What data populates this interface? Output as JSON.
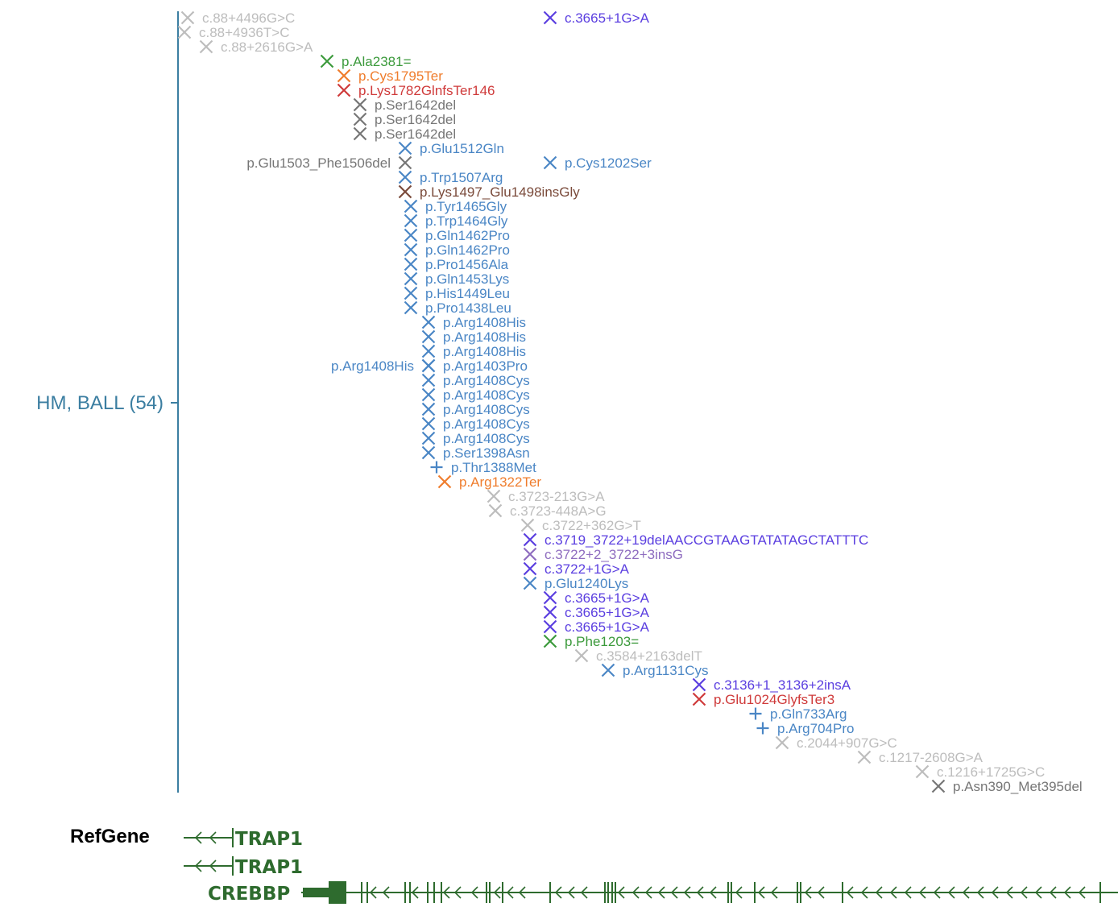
{
  "track": {
    "label": "HM, BALL (54)",
    "axis_color": "#3b7ea1"
  },
  "colors": {
    "gray": "#bdbdbd",
    "darkgray": "#767676",
    "blue": "#4a86c5",
    "purple": "#5b3fe0",
    "violet": "#8e6cbf",
    "green": "#3c9a3c",
    "orange": "#ef7d2d",
    "red": "#cf3a3a",
    "brown": "#7a4a3a",
    "gene": "#2e6b2e"
  },
  "mutations": [
    {
      "label": "c.88+4496G>C",
      "color": "gray",
      "marker": "x"
    },
    {
      "label": "c.88+4936T>C",
      "color": "gray",
      "marker": "x"
    },
    {
      "label": "c.88+2616G>A",
      "color": "gray",
      "marker": "x"
    },
    {
      "label": "p.Ala2381=",
      "color": "green",
      "marker": "x"
    },
    {
      "label": "p.Cys1795Ter",
      "color": "orange",
      "marker": "x"
    },
    {
      "label": "p.Lys1782GlnfsTer146",
      "color": "red",
      "marker": "x"
    },
    {
      "label": "p.Ser1642del",
      "color": "darkgray",
      "marker": "x"
    },
    {
      "label": "p.Ser1642del",
      "color": "darkgray",
      "marker": "x"
    },
    {
      "label": "p.Ser1642del",
      "color": "darkgray",
      "marker": "x"
    },
    {
      "label": "p.Glu1512Gln",
      "color": "blue",
      "marker": "x"
    },
    {
      "label": "p.Glu1503_Phe1506del",
      "color": "darkgray",
      "marker": "x",
      "side": "left"
    },
    {
      "label": "p.Trp1507Arg",
      "color": "blue",
      "marker": "x"
    },
    {
      "label": "p.Lys1497_Glu1498insGly",
      "color": "brown",
      "marker": "x"
    },
    {
      "label": "p.Tyr1465Gly",
      "color": "blue",
      "marker": "x"
    },
    {
      "label": "p.Trp1464Gly",
      "color": "blue",
      "marker": "x"
    },
    {
      "label": "p.Gln1462Pro",
      "color": "blue",
      "marker": "x"
    },
    {
      "label": "p.Gln1462Pro",
      "color": "blue",
      "marker": "x"
    },
    {
      "label": "p.Pro1456Ala",
      "color": "blue",
      "marker": "x"
    },
    {
      "label": "p.Gln1453Lys",
      "color": "blue",
      "marker": "x"
    },
    {
      "label": "p.His1449Leu",
      "color": "blue",
      "marker": "x"
    },
    {
      "label": "p.Pro1438Leu",
      "color": "blue",
      "marker": "x"
    },
    {
      "label": "p.Arg1408His",
      "color": "blue",
      "marker": "x"
    },
    {
      "label": "p.Arg1408His",
      "color": "blue",
      "marker": "x"
    },
    {
      "label": "p.Arg1408His",
      "color": "blue",
      "marker": "x"
    },
    {
      "label": "p.Arg1408His",
      "color": "blue",
      "marker": "x",
      "side": "left"
    },
    {
      "label": "p.Arg1403Pro",
      "color": "blue",
      "marker": "x"
    },
    {
      "label": "p.Arg1408Cys",
      "color": "blue",
      "marker": "x"
    },
    {
      "label": "p.Arg1408Cys",
      "color": "blue",
      "marker": "x"
    },
    {
      "label": "p.Arg1408Cys",
      "color": "blue",
      "marker": "x"
    },
    {
      "label": "p.Arg1408Cys",
      "color": "blue",
      "marker": "x"
    },
    {
      "label": "p.Arg1408Cys",
      "color": "blue",
      "marker": "x"
    },
    {
      "label": "p.Ser1398Asn",
      "color": "blue",
      "marker": "x"
    },
    {
      "label": "p.Thr1388Met",
      "color": "blue",
      "marker": "plus"
    },
    {
      "label": "p.Arg1322Ter",
      "color": "orange",
      "marker": "x"
    },
    {
      "label": "c.3723-213G>A",
      "color": "gray",
      "marker": "x"
    },
    {
      "label": "c.3723-448A>G",
      "color": "gray",
      "marker": "x"
    },
    {
      "label": "c.3722+362G>T",
      "color": "gray",
      "marker": "x"
    },
    {
      "label": "c.3719_3722+19delAACCGTAAGTATATAGCTATTTC",
      "color": "purple",
      "marker": "x"
    },
    {
      "label": "c.3722+2_3722+3insG",
      "color": "violet",
      "marker": "x"
    },
    {
      "label": "c.3722+1G>A",
      "color": "purple",
      "marker": "x"
    },
    {
      "label": "p.Glu1240Lys",
      "color": "blue",
      "marker": "x"
    },
    {
      "label": "c.3665+1G>A",
      "color": "purple",
      "marker": "x"
    },
    {
      "label": "c.3665+1G>A",
      "color": "purple",
      "marker": "x"
    },
    {
      "label": "c.3665+1G>A",
      "color": "purple",
      "marker": "x"
    },
    {
      "label": "c.3665+1G>A",
      "color": "purple",
      "marker": "x"
    },
    {
      "label": "p.Cys1202Ser",
      "color": "blue",
      "marker": "x"
    },
    {
      "label": "p.Phe1203=",
      "color": "green",
      "marker": "x"
    },
    {
      "label": "c.3584+2163delT",
      "color": "gray",
      "marker": "x"
    },
    {
      "label": "p.Arg1131Cys",
      "color": "blue",
      "marker": "x"
    },
    {
      "label": "c.3136+1_3136+2insA",
      "color": "purple",
      "marker": "x"
    },
    {
      "label": "p.Glu1024GlyfsTer3",
      "color": "red",
      "marker": "x"
    },
    {
      "label": "p.Gln733Arg",
      "color": "blue",
      "marker": "plus"
    },
    {
      "label": "p.Arg704Pro",
      "color": "blue",
      "marker": "plus"
    },
    {
      "label": "c.2044+907G>C",
      "color": "gray",
      "marker": "x"
    },
    {
      "label": "c.1217-2608G>A",
      "color": "gray",
      "marker": "x"
    },
    {
      "label": "c.1216+1725G>C",
      "color": "gray",
      "marker": "x"
    },
    {
      "label": "p.Asn390_Met395del",
      "color": "darkgray",
      "marker": "x"
    }
  ],
  "refgene": {
    "label": "RefGene",
    "genes": [
      {
        "name": "TRAP1",
        "strand": "-"
      },
      {
        "name": "TRAP1",
        "strand": "-"
      },
      {
        "name": "CREBBP",
        "strand": "-"
      }
    ]
  }
}
